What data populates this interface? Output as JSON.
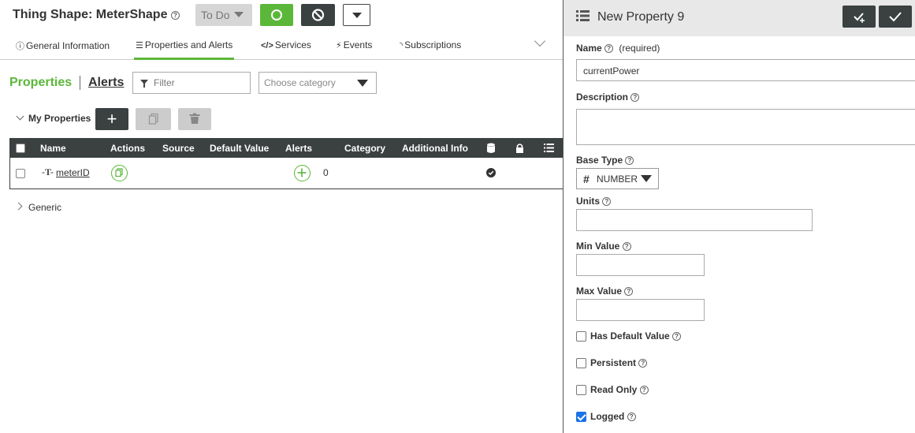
{
  "header": {
    "title": "Thing Shape: MeterShape",
    "state_label": "To Do",
    "help_icon": "question-circle-icon"
  },
  "tabs": [
    {
      "label": "General Information",
      "icon": "info-circle-icon"
    },
    {
      "label": "Properties and Alerts",
      "icon": "list-icon",
      "active": true
    },
    {
      "label": "Services",
      "icon": "code-icon"
    },
    {
      "label": "Events",
      "icon": "lightning-icon"
    },
    {
      "label": "Subscriptions",
      "icon": "rss-icon"
    }
  ],
  "subbar": {
    "properties_label": "Properties",
    "alerts_label": "Alerts",
    "filter_placeholder": "Filter",
    "category_placeholder": "Choose category"
  },
  "my_properties": {
    "label": "My Properties",
    "add_label": "+"
  },
  "table": {
    "columns": [
      "Name",
      "Actions",
      "Source",
      "Default Value",
      "Alerts",
      "Category",
      "Additional Info"
    ],
    "rows": [
      {
        "type_icon": "-T-",
        "name": "meterID",
        "alerts_count": "0",
        "logged": true
      }
    ]
  },
  "generic_label": "Generic",
  "panel": {
    "title": "New Property 9",
    "name_label": "Name",
    "name_required": "(required)",
    "name_value": "currentPower",
    "description_label": "Description",
    "base_type_label": "Base Type",
    "base_type_value": "NUMBER",
    "units_label": "Units",
    "min_label": "Min Value",
    "max_label": "Max Value",
    "checkboxes": [
      {
        "label": "Has Default Value",
        "checked": false
      },
      {
        "label": "Persistent",
        "checked": false
      },
      {
        "label": "Read Only",
        "checked": false
      },
      {
        "label": "Logged",
        "checked": true
      }
    ]
  },
  "colors": {
    "accent_green": "#5bb739",
    "dark": "#3b4041",
    "check_blue": "#1a73e8"
  }
}
